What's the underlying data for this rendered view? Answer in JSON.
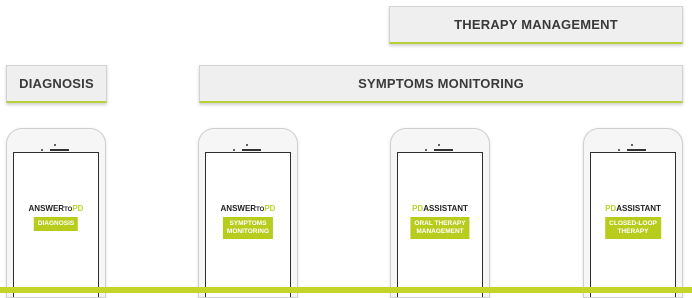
{
  "banners": {
    "therapy_management": "THERAPY MANAGEMENT",
    "diagnosis": "DIAGNOSIS",
    "symptoms_monitoring": "SYMPTOMS MONITORING"
  },
  "phones": [
    {
      "brand_a": "ANSWER",
      "brand_b": "TO",
      "brand_c": "PD",
      "chip_line1": "DIAGNOSIS",
      "chip_line2": ""
    },
    {
      "brand_a": "ANSWER",
      "brand_b": "TO",
      "brand_c": "PD",
      "chip_line1": "SYMPTOMS",
      "chip_line2": "MONITORING"
    },
    {
      "brand_a": "PD",
      "brand_b": "ASSISTANT",
      "chip_line1": "ORAL THERAPY",
      "chip_line2": "MANAGEMENT"
    },
    {
      "brand_a": "PD",
      "brand_b": "ASSISTANT",
      "chip_line1": "CLOSED-LOOP",
      "chip_line2": "THERAPY"
    }
  ],
  "colors": {
    "accent": "#b8cc1e",
    "banner_bg": "#efefef",
    "text": "#3a3a3a"
  }
}
